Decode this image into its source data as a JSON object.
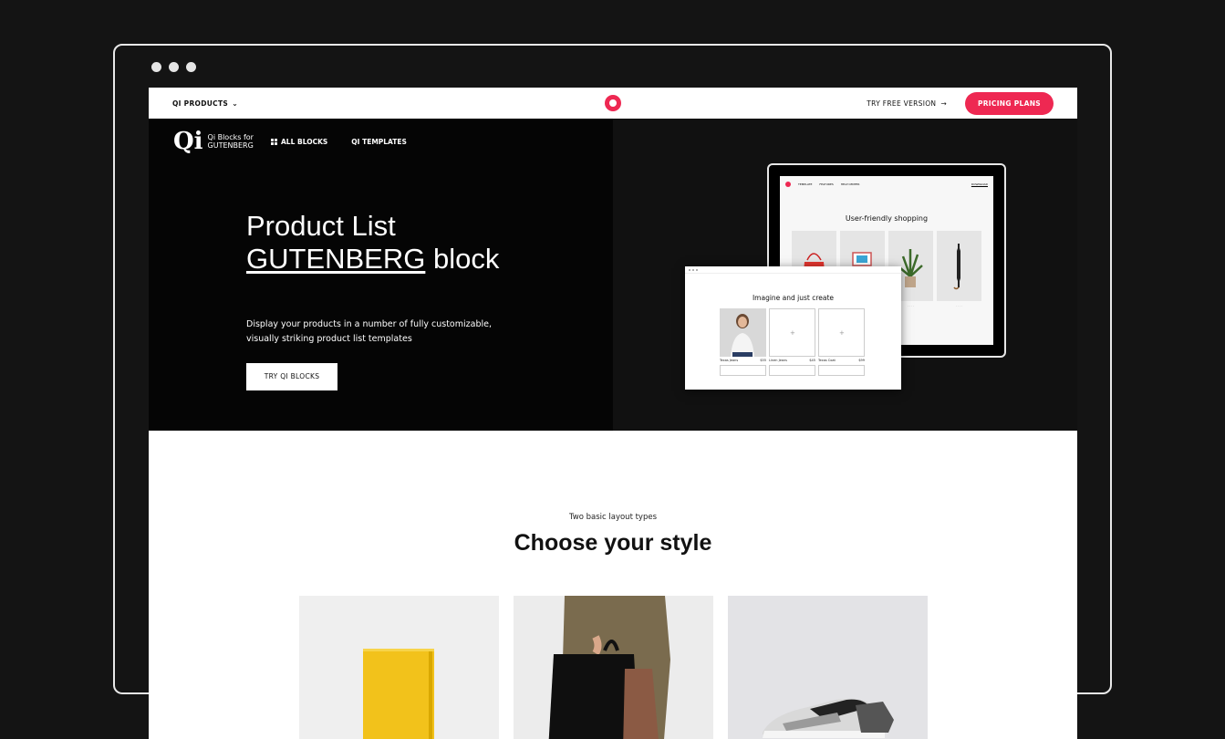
{
  "topbar": {
    "products_label": "QI PRODUCTS",
    "try_free_label": "TRY FREE VERSION",
    "pricing_label": "PRICING PLANS",
    "accent_color": "#ee2852"
  },
  "hero": {
    "logo_mark": "Qi",
    "logo_text_line1": "Qi Blocks for",
    "logo_text_line2": "GUTENBERG",
    "nav": [
      "ALL BLOCKS",
      "QI TEMPLATES"
    ],
    "title_line1": "Product List",
    "title_line2_underlined": "GUTENBERG",
    "title_line2_rest": " block",
    "description": "Display your products in a number of fully customizable, visually striking product list templates",
    "cta_label": "TRY QI BLOCKS"
  },
  "tablet_mockup": {
    "nav": [
      "TEMPLATE",
      "FEATURES",
      "HELP CENTER"
    ],
    "download": "DOWNLOAD",
    "title": "User-friendly shopping"
  },
  "laptop_mockup": {
    "title": "Imagine and just create",
    "items": [
      {
        "name": "Texas Jeans",
        "price": "$55"
      },
      {
        "name": "Linen Jeans",
        "price": "$45"
      },
      {
        "name": "Texas Coat",
        "price": "$99"
      }
    ]
  },
  "section": {
    "kicker": "Two basic layout types",
    "title": "Choose your style"
  }
}
